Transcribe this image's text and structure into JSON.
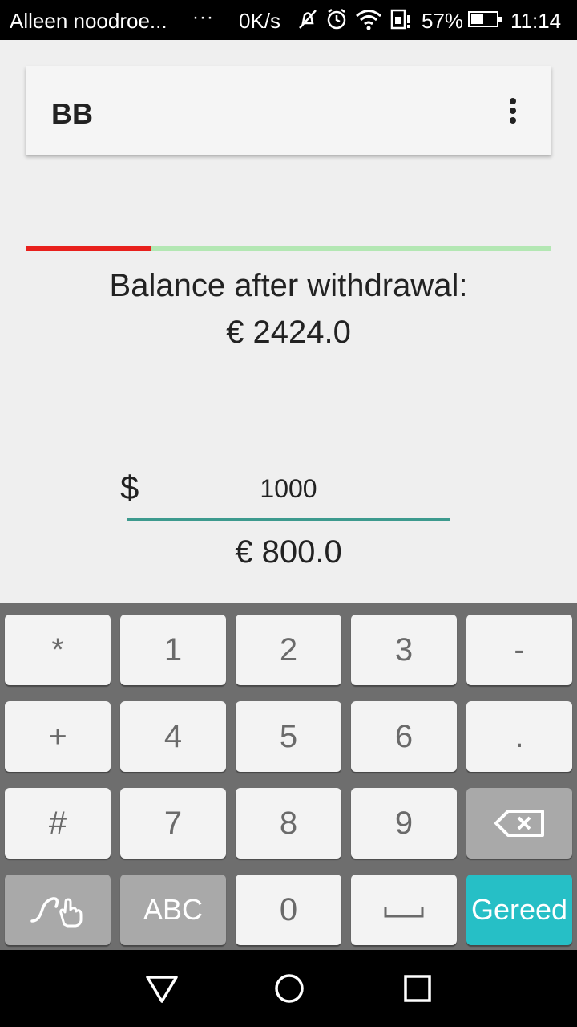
{
  "status_bar": {
    "carrier": "Alleen noodroe...",
    "more": "···",
    "speed": "0K/s",
    "battery_percent": "57%",
    "battery_level": 0.57,
    "time": "11:14"
  },
  "app_bar": {
    "title": "BB"
  },
  "progress": {
    "fraction": 0.24,
    "filled_color": "#e8201c",
    "track_color": "#b3e7b3"
  },
  "balance": {
    "label": "Balance after withdrawal:",
    "value": "€ 2424.0"
  },
  "amount": {
    "currency_symbol": "$",
    "value": "1000",
    "converted": "€ 800.0"
  },
  "keyboard": {
    "rows": [
      [
        "*",
        "1",
        "2",
        "3",
        "-"
      ],
      [
        "+",
        "4",
        "5",
        "6",
        "."
      ],
      [
        "#",
        "7",
        "8",
        "9",
        ""
      ],
      [
        "",
        "ABC",
        "0",
        "",
        "Gereed"
      ]
    ],
    "done_color": "#26bfc6"
  }
}
